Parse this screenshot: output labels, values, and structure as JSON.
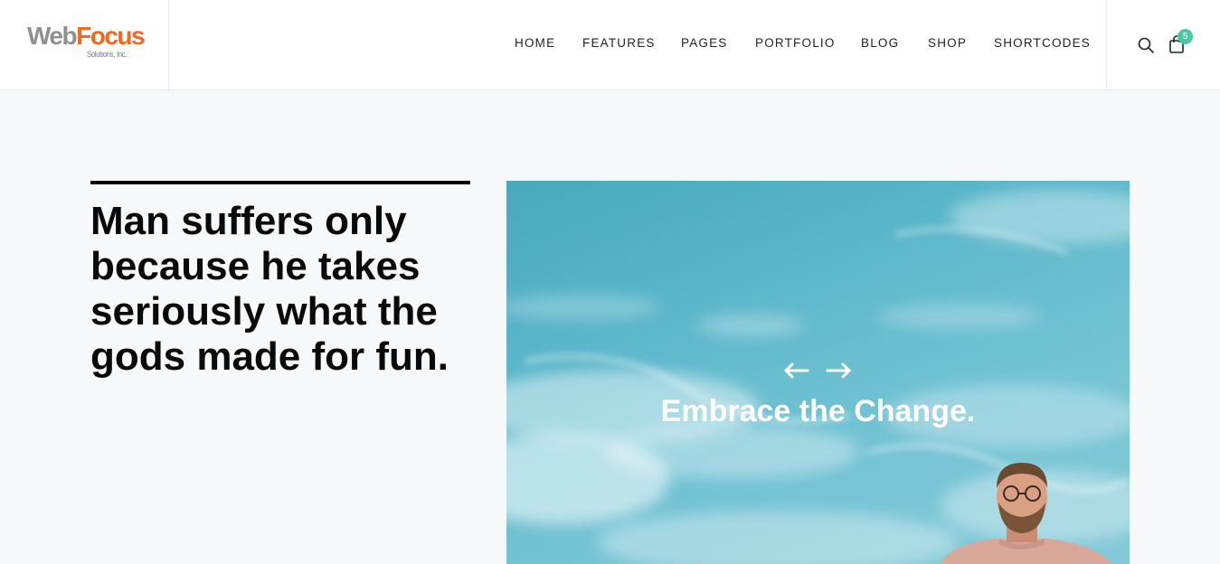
{
  "logo": {
    "primary_1": "Web",
    "primary_2": "Focus",
    "subtitle": "Solutions, Inc."
  },
  "nav": {
    "items": [
      {
        "label": "HOME"
      },
      {
        "label": "FEATURES"
      },
      {
        "label": "PAGES"
      },
      {
        "label": "PORTFOLIO"
      },
      {
        "label": "BLOG"
      },
      {
        "label": "SHOP"
      },
      {
        "label": "SHORTCODES"
      }
    ]
  },
  "cart": {
    "count": "5"
  },
  "quote": {
    "text": "Man suffers only because he takes seriously what the gods made for fun."
  },
  "hero": {
    "title": "Embrace the Change."
  },
  "colors": {
    "accent": "#48c9a5",
    "logo_focus": "#ef6a1f",
    "logo_web": "#8f8f8f",
    "sky": "#5ab6c9"
  },
  "icons": {
    "search": "search-icon",
    "cart": "shopping-bag-icon",
    "prev": "arrow-left-icon",
    "next": "arrow-right-icon"
  }
}
